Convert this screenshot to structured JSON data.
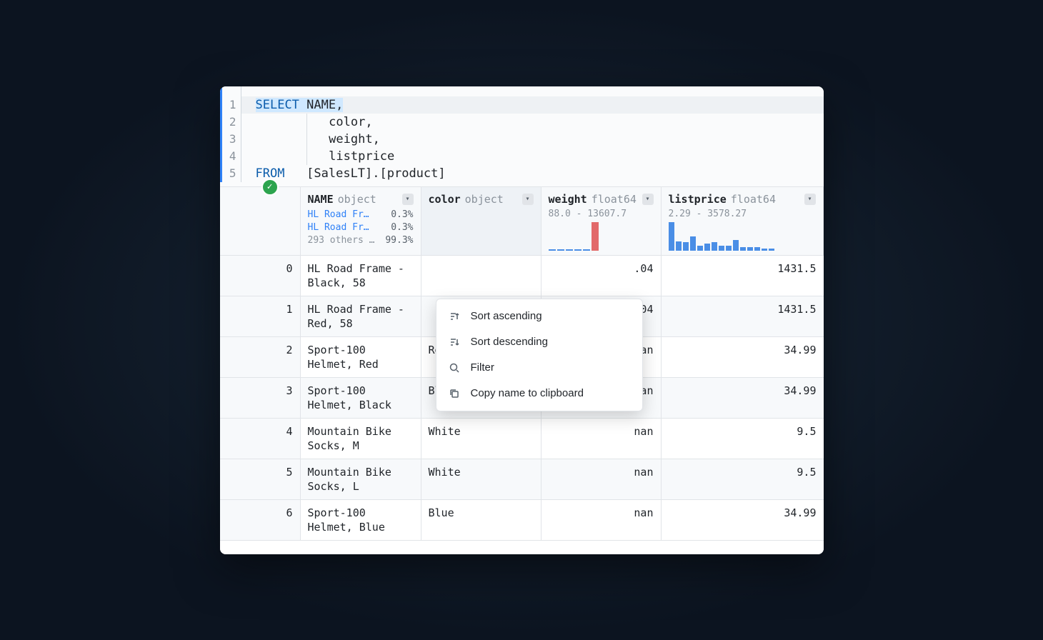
{
  "editor": {
    "lines": [
      "1",
      "2",
      "3",
      "4",
      "5"
    ],
    "code": {
      "l1_select": "SELECT",
      "l1_rest": " NAME,",
      "l2": "color,",
      "l3": "weight,",
      "l4": "listprice",
      "l5_from": "FROM",
      "l5_rest": "   [SalesLT].[product]"
    }
  },
  "status": {
    "icon": "✓"
  },
  "headers": {
    "name": {
      "label": "NAME",
      "type": "object"
    },
    "color": {
      "label": "color",
      "type": "object"
    },
    "weight": {
      "label": "weight",
      "type": "float64",
      "range": "88.0 - 13607.7"
    },
    "listprice": {
      "label": "listprice",
      "type": "float64",
      "range": "2.29 - 3578.27"
    }
  },
  "name_summary": {
    "l1_label": "HL Road Fr…",
    "l1_pct": "0.3%",
    "l2_label": "HL Road Fr…",
    "l2_pct": "0.3%",
    "l3_label": "293 others …",
    "l3_pct": "99.3%"
  },
  "rows": [
    {
      "idx": "0",
      "name": "HL Road Frame - Black, 58",
      "color": "",
      "weight": ".04",
      "listprice": "1431.5"
    },
    {
      "idx": "1",
      "name": "HL Road Frame - Red, 58",
      "color": "",
      "weight": ".04",
      "listprice": "1431.5"
    },
    {
      "idx": "2",
      "name": "Sport-100 Helmet, Red",
      "color": "Red",
      "weight": "nan",
      "listprice": "34.99"
    },
    {
      "idx": "3",
      "name": "Sport-100 Helmet, Black",
      "color": "Black",
      "weight": "nan",
      "listprice": "34.99"
    },
    {
      "idx": "4",
      "name": "Mountain Bike Socks, M",
      "color": "White",
      "weight": "nan",
      "listprice": "9.5"
    },
    {
      "idx": "5",
      "name": "Mountain Bike Socks, L",
      "color": "White",
      "weight": "nan",
      "listprice": "9.5"
    },
    {
      "idx": "6",
      "name": "Sport-100 Helmet, Blue",
      "color": "Blue",
      "weight": "nan",
      "listprice": "34.99"
    }
  ],
  "menu": {
    "sort_asc": "Sort ascending",
    "sort_desc": "Sort descending",
    "filter": "Filter",
    "copy": "Copy name to clipboard"
  }
}
